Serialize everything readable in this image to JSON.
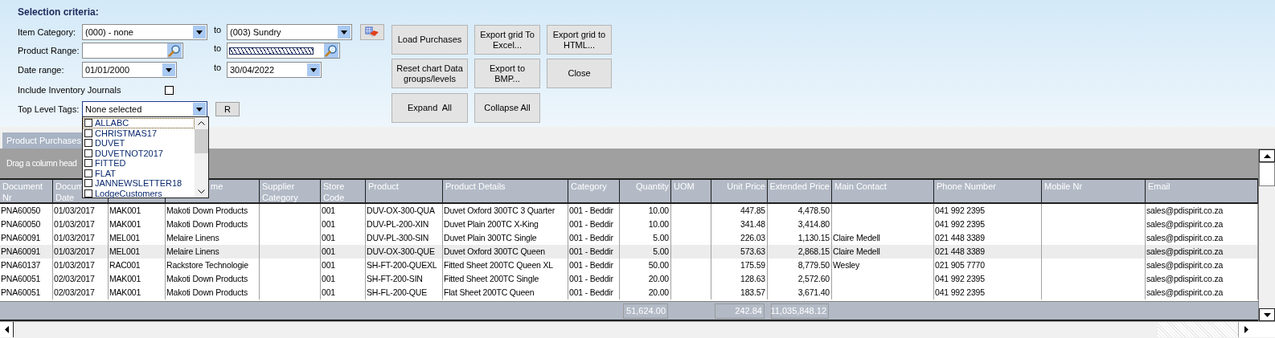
{
  "title": "Selection criteria:",
  "item_category": {
    "label": "Item Category:",
    "from": "(000) - none",
    "to_label": "to",
    "to": "(003) Sundry"
  },
  "product_range": {
    "label": "Product Range:",
    "to_label": "to",
    "masked": true
  },
  "date_range": {
    "label": "Date range:",
    "from": "01/01/2000",
    "to_label": "to",
    "to": "30/04/2022"
  },
  "include_inventory_journals": {
    "label": "Include Inventory Journals",
    "checked": false
  },
  "top_level_tags": {
    "label": "Top Level Tags:",
    "value": "None selected",
    "reset_button": "R",
    "expanded": true,
    "options": [
      {
        "label": "ALLABC",
        "checked": false,
        "focused": true
      },
      {
        "label": "CHRISTMAS17",
        "checked": false,
        "focused": false
      },
      {
        "label": "DUVET",
        "checked": false,
        "focused": false
      },
      {
        "label": "DUVETNOT2017",
        "checked": false,
        "focused": false
      },
      {
        "label": "FITTED",
        "checked": false,
        "focused": false
      },
      {
        "label": "FLAT",
        "checked": false,
        "focused": false
      },
      {
        "label": "JANNEWSLETTER18",
        "checked": false,
        "focused": false
      },
      {
        "label": "LodgeCustomers",
        "checked": false,
        "focused": false
      }
    ]
  },
  "buttons": [
    {
      "lines": [
        "Load Purchases"
      ]
    },
    {
      "lines": [
        "Export grid To",
        "Excel..."
      ]
    },
    {
      "lines": [
        "Export grid to",
        "HTML..."
      ]
    },
    {
      "lines": [
        "Reset chart Data",
        "groups/levels"
      ]
    },
    {
      "lines": [
        "Export to",
        "BMP..."
      ]
    },
    {
      "lines": [
        "Close"
      ]
    },
    {
      "lines": [
        "Expand  All"
      ]
    },
    {
      "lines": [
        "Collapse All"
      ]
    }
  ],
  "tabs": [
    {
      "label": "Product Purchases",
      "selected": true
    }
  ],
  "grid": {
    "group_hint": "Drag a column head",
    "columns": [
      {
        "lines": [
          "Document",
          "Nr"
        ],
        "kind": "text"
      },
      {
        "lines": [
          "Docum",
          "Date"
        ],
        "kind": "text"
      },
      {
        "kind": "text"
      },
      {
        "lines": [
          "me"
        ],
        "kind": "text"
      },
      {
        "lines": [
          "Supplier",
          "Category"
        ],
        "kind": "text"
      },
      {
        "lines": [
          "Store",
          "Code"
        ],
        "kind": "text"
      },
      {
        "lines": [
          "Product"
        ],
        "kind": "text"
      },
      {
        "lines": [
          "Product Details"
        ],
        "kind": "text"
      },
      {
        "lines": [
          "Category"
        ],
        "kind": "text"
      },
      {
        "lines": [
          "Quantity"
        ],
        "kind": "number",
        "total": "51,624.00"
      },
      {
        "lines": [
          "UOM"
        ],
        "kind": "text"
      },
      {
        "lines": [
          "Unit Price"
        ],
        "kind": "number",
        "total": "242.84"
      },
      {
        "lines": [
          "Extended Price"
        ],
        "kind": "number",
        "total": "11,035,848.12"
      },
      {
        "lines": [
          "Main Contact"
        ],
        "kind": "text"
      },
      {
        "lines": [
          "Phone Number"
        ],
        "kind": "text"
      },
      {
        "lines": [
          "Mobile Nr"
        ],
        "kind": "text"
      },
      {
        "lines": [
          "Email"
        ],
        "kind": "text"
      }
    ],
    "rows": [
      {
        "selected": false,
        "document_nr": "PNA60050",
        "document_date": "01/03/2017",
        "column_3": "MAK001",
        "column_4": "Makoti Down Products",
        "store_code": "001",
        "product": "DUV-OX-300-QUA",
        "product_details": "Duvet Oxford 300TC 3 Quarter",
        "category": "001 - Beddir",
        "quantity": "10.00",
        "unit_price": "447.85",
        "extended_price": "4,478.50",
        "phone_number": "041 992 2395",
        "email": "sales@pdispirit.co.za"
      },
      {
        "selected": false,
        "document_nr": "PNA60050",
        "document_date": "01/03/2017",
        "column_3": "MAK001",
        "column_4": "Makoti Down Products",
        "store_code": "001",
        "product": "DUV-PL-200-XIN",
        "product_details": "Duvet Plain 200TC X-King",
        "category": "001 - Beddir",
        "quantity": "10.00",
        "unit_price": "341.48",
        "extended_price": "3,414.80",
        "phone_number": "041 992 2395",
        "email": "sales@pdispirit.co.za"
      },
      {
        "selected": false,
        "document_nr": "PNA60091",
        "document_date": "01/03/2017",
        "column_3": "MEL001",
        "column_4": "Melaire Linens",
        "store_code": "001",
        "product": "DUV-PL-300-SIN",
        "product_details": "Duvet Plain 300TC Single",
        "category": "001 - Beddir",
        "quantity": "5.00",
        "unit_price": "226.03",
        "extended_price": "1,130.15",
        "main_contact": "Claire Medell",
        "phone_number": "021 448 3389",
        "email": "sales@pdispirit.co.za"
      },
      {
        "selected": true,
        "document_nr": "PNA60091",
        "document_date": "01/03/2017",
        "column_3": "MEL001",
        "column_4": "Melaire Linens",
        "store_code": "001",
        "product": "DUV-OX-300-QUE",
        "product_details": "Duvet Oxford 300TC Queen",
        "category": "001 - Beddir",
        "quantity": "5.00",
        "unit_price": "573.63",
        "extended_price": "2,868.15",
        "main_contact": "Claire Medell",
        "phone_number": "021 448 3389",
        "email": "sales@pdispirit.co.za"
      },
      {
        "selected": false,
        "document_nr": "PNA60137",
        "document_date": "01/03/2017",
        "column_3": "RAC001",
        "column_4": "Rackstore Technologie",
        "store_code": "001",
        "product": "SH-FT-200-QUEXL",
        "product_details": "Fitted Sheet 200TC Queen XL",
        "category": "001 - Beddir",
        "quantity": "50.00",
        "unit_price": "175.59",
        "extended_price": "8,779.50",
        "main_contact": "Wesley",
        "phone_number": "021 905 7770",
        "email": "sales@pdispirit.co.za"
      },
      {
        "selected": false,
        "document_nr": "PNA60051",
        "document_date": "02/03/2017",
        "column_3": "MAK001",
        "column_4": "Makoti Down Products",
        "store_code": "001",
        "product": "SH-FT-200-SIN",
        "product_details": "Fitted Sheet 200TC Single",
        "category": "001 - Beddir",
        "quantity": "20.00",
        "unit_price": "128.63",
        "extended_price": "2,572.60",
        "phone_number": "041 992 2395",
        "email": "sales@pdispirit.co.za"
      },
      {
        "selected": false,
        "document_nr": "PNA60051",
        "document_date": "02/03/2017",
        "column_3": "MAK001",
        "column_4": "Makoti Down Products",
        "store_code": "001",
        "product": "SH-FL-200-QUE",
        "product_details": "Flat Sheet 200TC Queen",
        "category": "001 - Beddir",
        "quantity": "20.00",
        "unit_price": "183.57",
        "extended_price": "3,671.40",
        "phone_number": "041 992 2395",
        "email": "sales@pdispirit.co.za"
      }
    ]
  }
}
